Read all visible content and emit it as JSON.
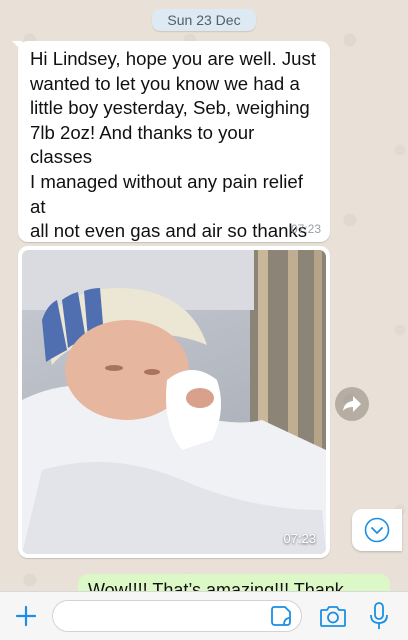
{
  "conversation": {
    "date_separator": "Sun 23 Dec",
    "messages": [
      {
        "direction": "incoming",
        "text": "Hi Lindsey, hope you are well. Just\nwanted to let you know we had a\nlittle boy yesterday, Seb, weighing\n7lb 2oz! And thanks to your classes\nI managed without any pain relief at\nall not even gas and air so thanks\nfor that! Hope you have a lovely\nChristmas x",
        "time": "07:23"
      },
      {
        "direction": "incoming",
        "type": "photo",
        "time": "07:23"
      },
      {
        "direction": "outgoing",
        "text": "Wow!!!! That’s amazing!!! Thank"
      }
    ]
  },
  "actions": {
    "forward_icon": "forward-arrow-icon",
    "scroll_down_icon": "chevron-down-icon"
  },
  "composer": {
    "plus_icon": "plus-icon",
    "input_value": "",
    "sticker_icon": "sticker-icon",
    "camera_icon": "camera-icon",
    "mic_icon": "microphone-icon"
  },
  "colors": {
    "accent": "#1a8fe3",
    "incoming_bubble": "#ffffff",
    "outgoing_bubble": "#dcf8c6",
    "wallpaper": "#e9e1d7"
  }
}
